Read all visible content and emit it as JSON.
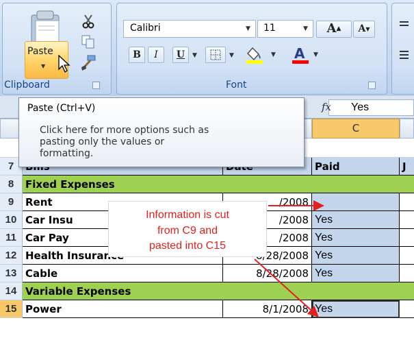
{
  "ribbon": {
    "clipboard": {
      "paste_label": "Paste",
      "group_label": "Clipboard",
      "icons": [
        "paste-icon",
        "cut-icon",
        "copy-icon",
        "format-painter-icon",
        "mouse-pointer-icon"
      ]
    },
    "font": {
      "font_name": "Calibri",
      "font_size": "11",
      "grow_label": "A",
      "shrink_label": "A",
      "bold_label": "B",
      "italic_label": "I",
      "underline_label": "U",
      "group_label": "Font",
      "fill_color": "#ffff00",
      "font_color": "#ff0000"
    }
  },
  "formula_bar": {
    "fx_label": "fx",
    "value": "Yes"
  },
  "tooltip": {
    "title": "Paste (Ctrl+V)",
    "body_lines": [
      "Click here for more options such as",
      "pasting only the values or",
      "formatting."
    ]
  },
  "grid": {
    "column_c_header": "C",
    "header_row": {
      "b": "Bills",
      "date": "Date",
      "paid": "Paid",
      "next": "J"
    },
    "rows": [
      {
        "num": "8",
        "b": "Fixed Expenses",
        "date": "",
        "paid": ""
      },
      {
        "num": "9",
        "b": "Rent",
        "date": "/2008",
        "paid": ""
      },
      {
        "num": "10",
        "b": "Car Insu",
        "date": "/2008",
        "paid": "Yes"
      },
      {
        "num": "11",
        "b": "Car Pay",
        "date": "/2008",
        "paid": "Yes"
      },
      {
        "num": "12",
        "b": "Health Insurance",
        "date": "8/28/2008",
        "paid": "Yes"
      },
      {
        "num": "13",
        "b": "Cable",
        "date": "8/28/2008",
        "paid": "Yes"
      },
      {
        "num": "14",
        "b": "Variable Expenses",
        "date": "",
        "paid": ""
      },
      {
        "num": "15",
        "b": "Power",
        "date": "8/1/2008",
        "paid": "Yes"
      }
    ]
  },
  "callout": {
    "lines": [
      "Information is cut",
      "from C9 and",
      "pasted into C15"
    ],
    "color": "#e2201e"
  }
}
